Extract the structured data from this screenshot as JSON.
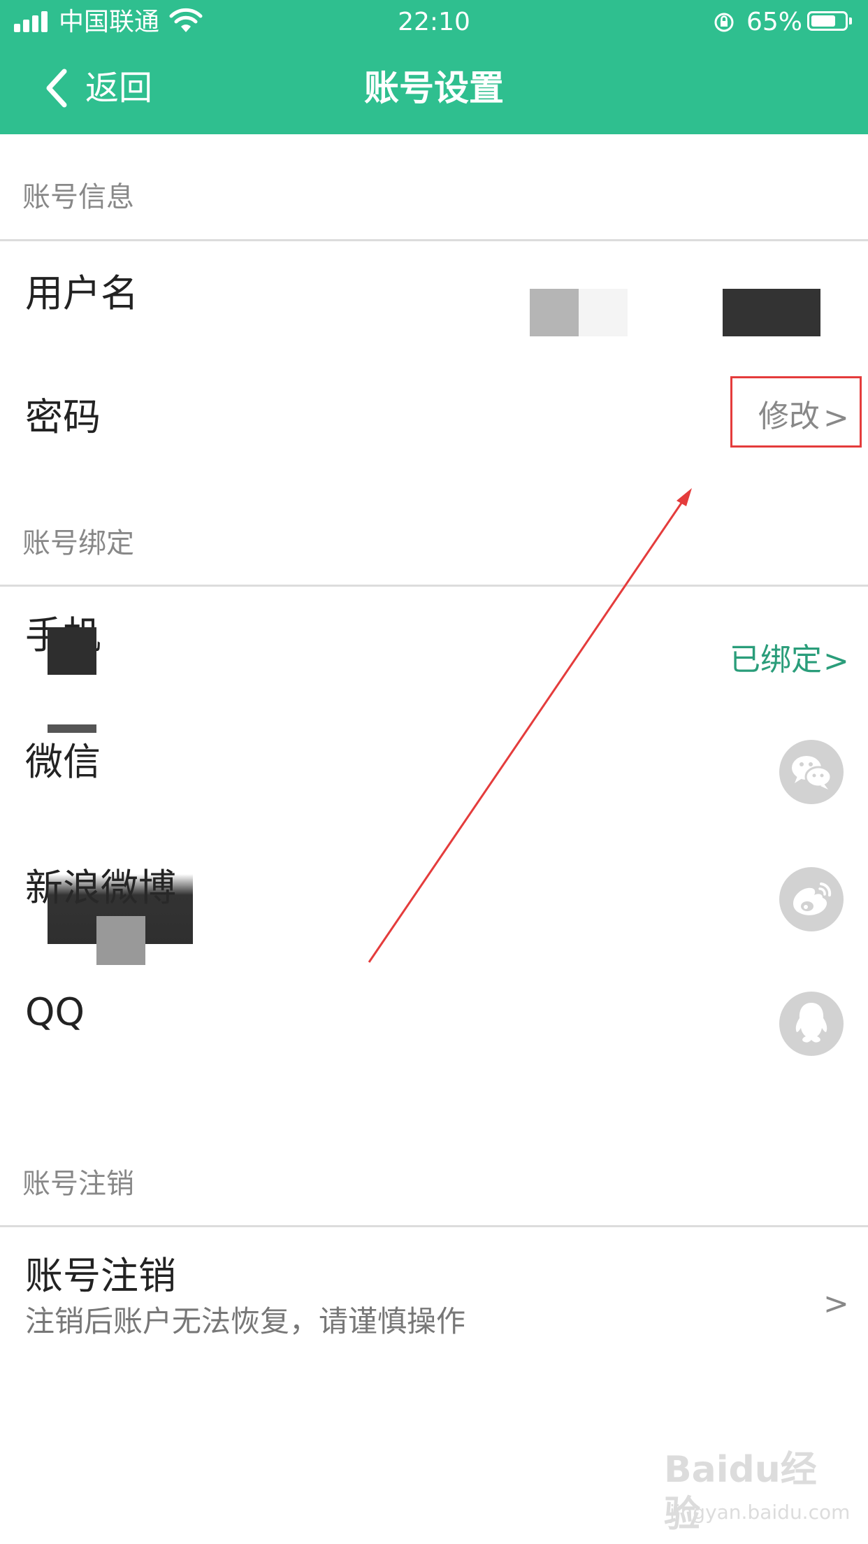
{
  "status_bar": {
    "carrier": "中国联通",
    "time": "22:10",
    "battery": "65%",
    "battery_level": 0.65
  },
  "header": {
    "back_label": "返回",
    "title": "账号设置"
  },
  "sections": {
    "account_info": {
      "heading": "账号信息",
      "username_label": "用户名",
      "password_label": "密码",
      "password_action": "修改",
      "chevron": ">"
    },
    "binding": {
      "heading": "账号绑定",
      "phone_label": "手机",
      "phone_status": "已绑定",
      "chevron": ">",
      "wechat_label": "微信",
      "weibo_label": "新浪微博",
      "qq_label": "QQ"
    },
    "cancel": {
      "heading": "账号注销",
      "row_label": "账号注销",
      "row_subtitle": "注销后账户无法恢复，请谨慎操作",
      "chevron": ">"
    }
  },
  "icons": {
    "wechat": "wechat-icon",
    "weibo": "weibo-icon",
    "qq": "qq-icon"
  },
  "colors": {
    "header_bg": "#2fbf8f",
    "accent_green": "#2a9d7a",
    "highlight_red": "#e43c3c"
  },
  "watermark": {
    "main": "Baidu经验",
    "sub": "jingyan.baidu.com"
  }
}
